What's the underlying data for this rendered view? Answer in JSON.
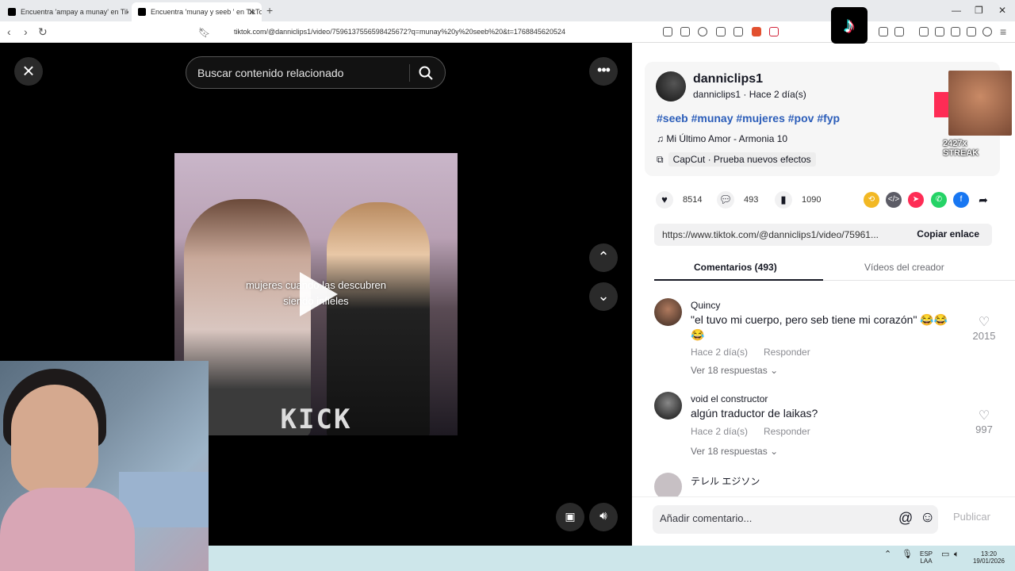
{
  "browser": {
    "tab1_title": "Encuentra 'ampay a munay' en TikTok",
    "tab2_title": "Encuentra 'munay y seeb ' en TikTok",
    "url": "tiktok.com/@danniclips1/video/7596137556598425672?q=munay%20y%20seeb%20&t=1768845620524"
  },
  "video": {
    "search_placeholder": "Buscar contenido relacionado",
    "caption_line1": "mujeres cuando las descubren",
    "caption_line2": "siendo infieles",
    "watermark": "KICK"
  },
  "post": {
    "username": "danniclips1",
    "subline": "danniclips1 · Hace 2 día(s)",
    "hashtags": "#seeb #munay #mujeres #pov #fyp",
    "music": "Mi Último Amor - Armonia 10",
    "capcut": "CapCut · Prueba nuevos efectos",
    "streak": "2427x STREAK",
    "likes": "8514",
    "comments": "493",
    "saves": "1090",
    "link": "https://www.tiktok.com/@danniclips1/video/75961...",
    "copy_label": "Copiar enlace"
  },
  "tabs": {
    "comments": "Comentarios (493)",
    "creator_videos": "Vídeos del creador"
  },
  "comments": [
    {
      "name": "Quincy",
      "text": "\"el tuvo mi cuerpo, pero seb tiene mi corazón\" 😂😂😂",
      "time": "Hace 2 día(s)",
      "reply": "Responder",
      "replies": "Ver 18 respuestas",
      "likes": "2015"
    },
    {
      "name": "void el constructor",
      "text": "algún traductor de laikas?",
      "time": "Hace 2 día(s)",
      "reply": "Responder",
      "replies": "Ver 18 respuestas",
      "likes": "997"
    },
    {
      "name": "テレル エジソン"
    }
  ],
  "comment_box": {
    "placeholder": "Añadir comentario...",
    "post_label": "Publicar"
  },
  "taskbar": {
    "lang": "ESP",
    "layout": "LAA",
    "time": "13:20",
    "date": "19/01/2026"
  }
}
